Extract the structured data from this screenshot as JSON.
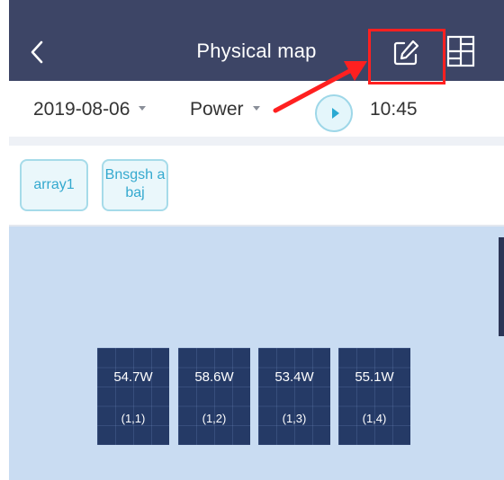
{
  "header": {
    "title": "Physical map",
    "icons": {
      "back": "chevron-left-icon",
      "edit": "edit-icon",
      "layout": "layout-grid-icon"
    },
    "background": "#3d4566"
  },
  "toolbar": {
    "date": "2019-08-06",
    "metric": "Power",
    "time": "10:45",
    "icons": {
      "play": "play-icon",
      "dropdown": "caret-down-icon"
    }
  },
  "arrays": [
    {
      "label": "array1"
    },
    {
      "label": "Bnsgsh abaj"
    }
  ],
  "map": {
    "background": "#c9dcf2",
    "panels": [
      {
        "power": "54.7W",
        "position": "(1,1)"
      },
      {
        "power": "58.6W",
        "position": "(1,2)"
      },
      {
        "power": "53.4W",
        "position": "(1,3)"
      },
      {
        "power": "55.1W",
        "position": "(1,4)"
      }
    ]
  },
  "colors": {
    "accent": "#2aa9d2",
    "annotation": "#ff2020",
    "panel": "#253a66"
  }
}
